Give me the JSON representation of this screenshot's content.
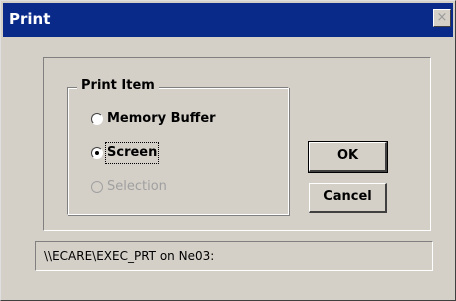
{
  "window": {
    "title": "Print",
    "close_glyph": "×"
  },
  "print_item_group": {
    "legend": "Print Item",
    "options": [
      {
        "label": "Memory Buffer",
        "selected": false,
        "disabled": false
      },
      {
        "label": "Screen",
        "selected": true,
        "disabled": false
      },
      {
        "label": "Selection",
        "selected": false,
        "disabled": true
      }
    ]
  },
  "buttons": {
    "ok_label": "OK",
    "cancel_label": "Cancel"
  },
  "status": {
    "printer_path": "\\\\ECARE\\EXEC_PRT on Ne03:"
  },
  "colors": {
    "titlebar": "#0a2a8a",
    "face": "#d4d0c8",
    "disabled_text": "#a0a0a0"
  }
}
